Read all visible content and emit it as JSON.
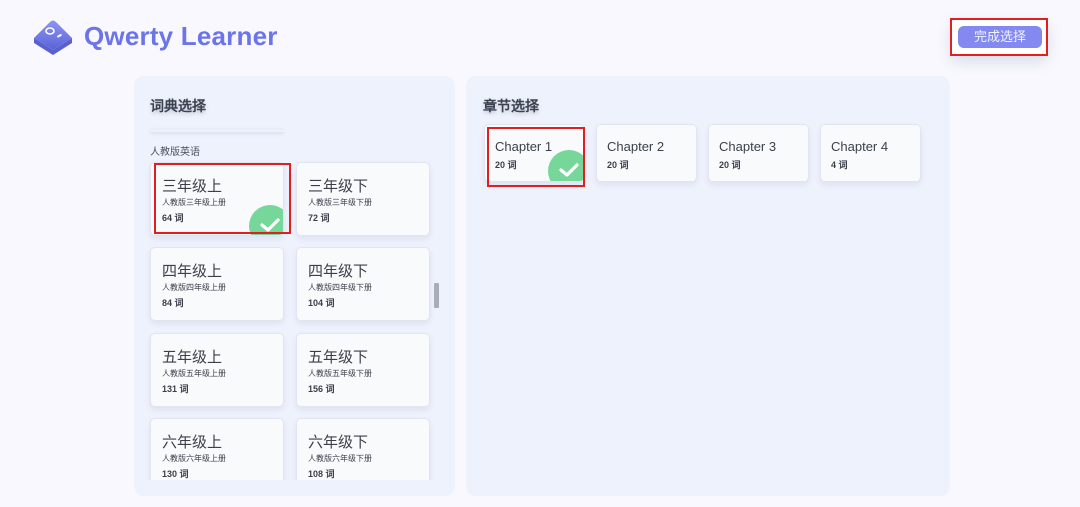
{
  "app": {
    "title": "Qwerty Learner",
    "logo_icon": "keycap-icon"
  },
  "header": {
    "finish_button_label": "完成选择"
  },
  "dictionary_panel": {
    "title": "词典选择",
    "group_label": "人教版英语",
    "selected_index": 0,
    "items": [
      {
        "name": "三年级上",
        "description": "人教版三年级上册",
        "count": "64 词",
        "selected": true
      },
      {
        "name": "三年级下",
        "description": "人教版三年级下册",
        "count": "72 词",
        "selected": false
      },
      {
        "name": "四年级上",
        "description": "人教版四年级上册",
        "count": "84 词",
        "selected": false
      },
      {
        "name": "四年级下",
        "description": "人教版四年级下册",
        "count": "104 词",
        "selected": false
      },
      {
        "name": "五年级上",
        "description": "人教版五年级上册",
        "count": "131 词",
        "selected": false
      },
      {
        "name": "五年级下",
        "description": "人教版五年级下册",
        "count": "156 词",
        "selected": false
      },
      {
        "name": "六年级上",
        "description": "人教版六年级上册",
        "count": "130 词",
        "selected": false
      },
      {
        "name": "六年级下",
        "description": "人教版六年级下册",
        "count": "108 词",
        "selected": false
      }
    ]
  },
  "chapter_panel": {
    "title": "章节选择",
    "selected_index": 0,
    "items": [
      {
        "name": "Chapter 1",
        "count": "20 词",
        "selected": true
      },
      {
        "name": "Chapter 2",
        "count": "20 词",
        "selected": false
      },
      {
        "name": "Chapter 3",
        "count": "20 词",
        "selected": false
      },
      {
        "name": "Chapter 4",
        "count": "4 词",
        "selected": false
      }
    ]
  },
  "colors": {
    "brand": "#6b74e8",
    "button": "#8389f0",
    "check": "#77d79a",
    "highlight": "#e02020",
    "panel": "#eef2fd"
  }
}
